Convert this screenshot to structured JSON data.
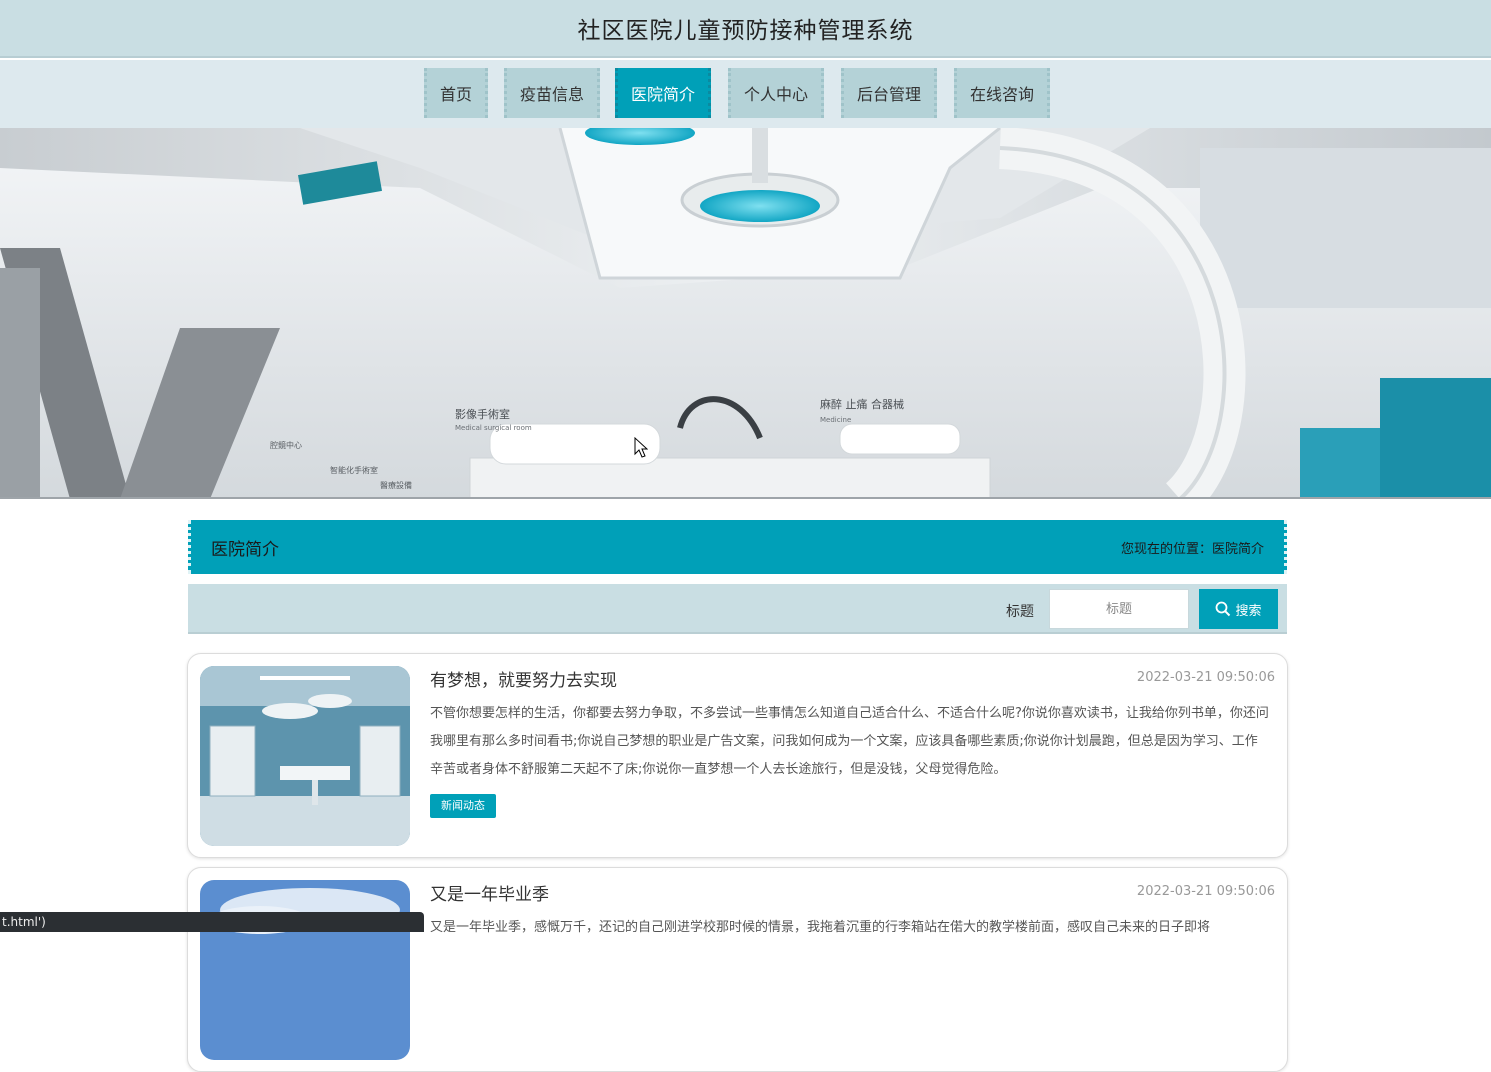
{
  "header": {
    "title": "社区医院儿童预防接种管理系统"
  },
  "nav": {
    "items": [
      {
        "label": "首页",
        "active": false
      },
      {
        "label": "疫苗信息",
        "active": false
      },
      {
        "label": "医院简介",
        "active": true
      },
      {
        "label": "个人中心",
        "active": false
      },
      {
        "label": "后台管理",
        "active": false
      },
      {
        "label": "在线咨询",
        "active": false
      }
    ]
  },
  "banner": {
    "image": "hospital-operating-room-photo",
    "sign_text": [
      "影像手術室",
      "Medical surgical room",
      "腔鏡中心",
      "智能化手術室",
      "醫療設備",
      "Medicine",
      "麻醉 止痛 合器械"
    ]
  },
  "section": {
    "title": "医院简介",
    "location_label": "您现在的位置：",
    "location_value": "医院简介"
  },
  "search": {
    "label": "标题",
    "placeholder": "标题",
    "button_label": "搜索",
    "button_icon": "search-icon"
  },
  "articles": [
    {
      "title": "有梦想，就要努力去实现",
      "time": "2022-03-21 09:50:06",
      "body": "不管你想要怎样的生活，你都要去努力争取，不多尝试一些事情怎么知道自己适合什么、不适合什么呢?你说你喜欢读书，让我给你列书单，你还问我哪里有那么多时间看书;你说自己梦想的职业是广告文案，问我如何成为一个文案，应该具备哪些素质;你说你计划晨跑，但总是因为学习、工作辛苦或者身体不舒服第二天起不了床;你说你一直梦想一个人去长途旅行，但是没钱，父母觉得危险。",
      "tag": "新闻动态",
      "thumb": "operating-room-photo"
    },
    {
      "title": "又是一年毕业季",
      "time": "2022-03-21 09:50:06",
      "body": "又是一年毕业季，感慨万千，还记的自己刚进学校那时候的情景，我拖着沉重的行李箱站在偌大的教学楼前面，感叹自己未来的日子即将",
      "tag": "",
      "thumb": "sky-photo"
    }
  ],
  "status_bar": {
    "url_text": "t.html')"
  },
  "colors": {
    "accent": "#00a0b8",
    "header_bg": "#c9dee3",
    "nav_bg": "#dde9ee",
    "nav_item_bg": "#b4d2d7"
  }
}
